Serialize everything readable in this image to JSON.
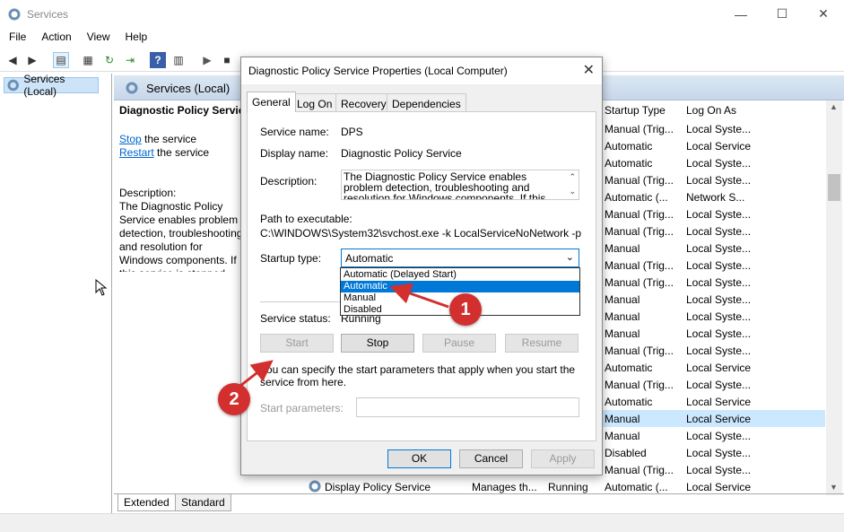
{
  "window": {
    "title": "Services"
  },
  "menu": [
    "File",
    "Action",
    "View",
    "Help"
  ],
  "left_pane": {
    "item": "Services (Local)"
  },
  "right_header": "Services (Local)",
  "details": {
    "service_title": "Diagnostic Policy Service",
    "stop_link": "Stop",
    "stop_suffix": " the service",
    "restart_link": "Restart",
    "restart_suffix": " the service",
    "description_label": "Description:",
    "description_text": "The Diagnostic Policy Service enables problem detection, troubleshooting and resolution for Windows components.  If this service is stopped, diagnostics will no longer function."
  },
  "columns": {
    "startup_type": "Startup Type",
    "log_on_as": "Log On As"
  },
  "rows": [
    {
      "startup": "Manual (Trig...",
      "logon": "Local Syste..."
    },
    {
      "startup": "Automatic",
      "logon": "Local Service"
    },
    {
      "startup": "Automatic",
      "logon": "Local Syste..."
    },
    {
      "startup": "Manual (Trig...",
      "logon": "Local Syste..."
    },
    {
      "startup": "Automatic (...",
      "logon": "Network S..."
    },
    {
      "startup": "Manual (Trig...",
      "logon": "Local Syste..."
    },
    {
      "startup": "Manual (Trig...",
      "logon": "Local Syste..."
    },
    {
      "startup": "Manual",
      "logon": "Local Syste..."
    },
    {
      "startup": "Manual (Trig...",
      "logon": "Local Syste..."
    },
    {
      "startup": "Manual (Trig...",
      "logon": "Local Syste..."
    },
    {
      "startup": "Manual",
      "logon": "Local Syste..."
    },
    {
      "startup": "Manual",
      "logon": "Local Syste..."
    },
    {
      "startup": "Manual",
      "logon": "Local Syste..."
    },
    {
      "startup": "Manual (Trig...",
      "logon": "Local Syste..."
    },
    {
      "startup": "Automatic",
      "logon": "Local Service"
    },
    {
      "startup": "Manual (Trig...",
      "logon": "Local Syste..."
    },
    {
      "startup": "Automatic",
      "logon": "Local Service"
    },
    {
      "startup": "Manual",
      "logon": "Local Service"
    },
    {
      "startup": "Manual",
      "logon": "Local Syste..."
    },
    {
      "startup": "Disabled",
      "logon": "Local Syste..."
    },
    {
      "startup": "Manual (Trig...",
      "logon": "Local Syste..."
    },
    {
      "startup": "Automatic (...",
      "logon": "Local Service"
    }
  ],
  "bottom_row": {
    "name": "Display Policy Service",
    "desc": "Manages th...",
    "status": "Running"
  },
  "bottom_tabs": [
    "Extended",
    "Standard"
  ],
  "dialog": {
    "title": "Diagnostic Policy Service Properties (Local Computer)",
    "tabs": [
      "General",
      "Log On",
      "Recovery",
      "Dependencies"
    ],
    "service_name_label": "Service name:",
    "service_name": "DPS",
    "display_name_label": "Display name:",
    "display_name": "Diagnostic Policy Service",
    "description_label": "Description:",
    "description": "The Diagnostic Policy Service enables problem detection, troubleshooting and resolution for Windows components.  If this service is stopped",
    "path_label": "Path to executable:",
    "path": "C:\\WINDOWS\\System32\\svchost.exe -k LocalServiceNoNetwork -p",
    "startup_type_label": "Startup type:",
    "startup_type_value": "Automatic",
    "startup_options": [
      "Automatic (Delayed Start)",
      "Automatic",
      "Manual",
      "Disabled"
    ],
    "service_status_label": "Service status:",
    "service_status": "Running",
    "buttons": {
      "start": "Start",
      "stop": "Stop",
      "pause": "Pause",
      "resume": "Resume"
    },
    "hint": "You can specify the start parameters that apply when you start the service from here.",
    "start_params_label": "Start parameters:",
    "ok": "OK",
    "cancel": "Cancel",
    "apply": "Apply"
  },
  "annotations": {
    "badge1": "1",
    "badge2": "2"
  },
  "colors": {
    "accent": "#0078d7",
    "badge": "#d32f2f",
    "selection": "#cce8ff"
  }
}
